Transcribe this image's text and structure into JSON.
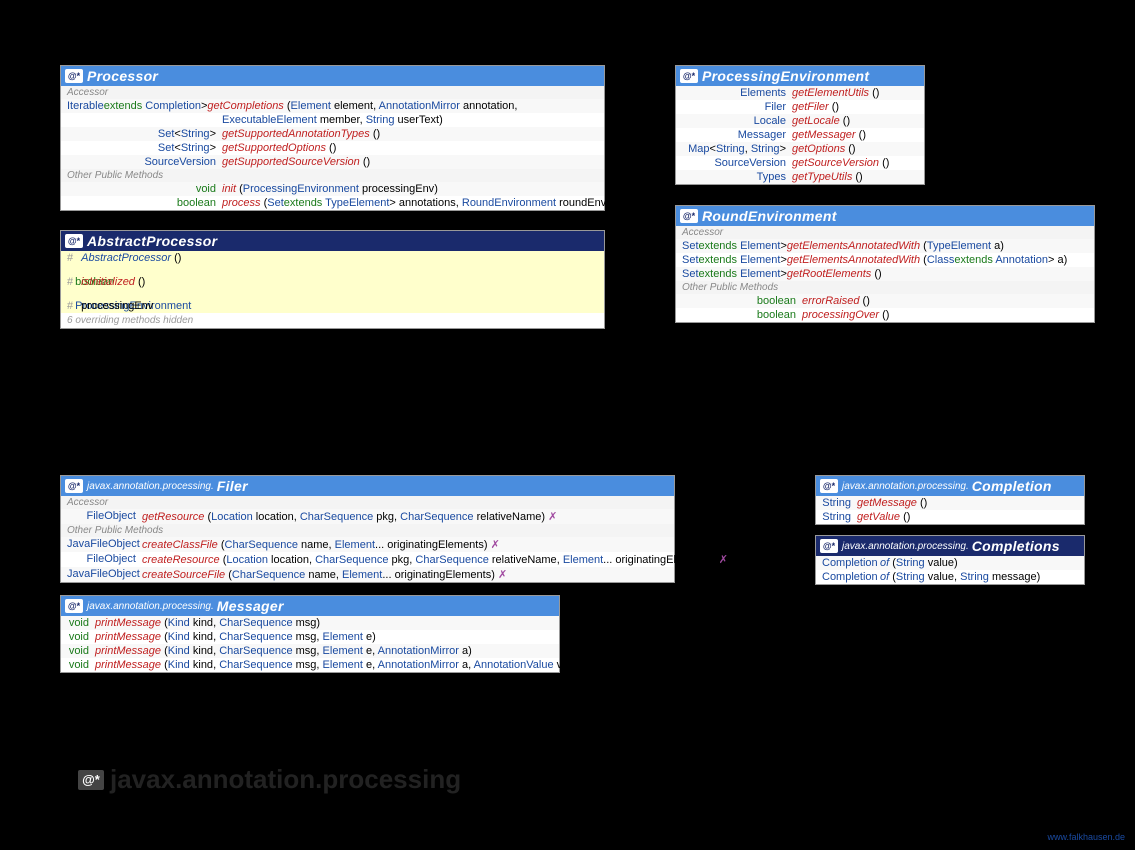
{
  "badge": "@*",
  "footer": {
    "title": "javax.annotation.processing"
  },
  "credit": "www.falkhausen.de",
  "boxes": {
    "processor": {
      "title": "Processor",
      "secAccessor": "Accessor",
      "secOther": "Other Public Methods",
      "rows": [
        {
          "ret": "Iterable<? extends Completion>",
          "m": "getCompletions",
          "sig": "(Element element, AnnotationMirror annotation,"
        },
        {
          "ret": "",
          "m": "",
          "sig": "ExecutableElement member, String userText)"
        },
        {
          "ret": "Set<String>",
          "m": "getSupportedAnnotationTypes",
          "sig": "()"
        },
        {
          "ret": "Set<String>",
          "m": "getSupportedOptions",
          "sig": "()"
        },
        {
          "ret": "SourceVersion",
          "m": "getSupportedSourceVersion",
          "sig": "()"
        }
      ],
      "other": [
        {
          "ret": "void",
          "m": "init",
          "sig": "(ProcessingEnvironment processingEnv)"
        },
        {
          "ret": "boolean",
          "m": "process",
          "sig": "(Set<? extends TypeElement> annotations, RoundEnvironment roundEnv)"
        }
      ]
    },
    "abstractProcessor": {
      "title": "AbstractProcessor",
      "rows": [
        {
          "hash": true,
          "ret": "",
          "m": "AbstractProcessor",
          "sig": "()",
          "mcolor": "#1a4aa0"
        },
        {
          "hash": true,
          "ret": "boolean",
          "m": "isInitialized",
          "sig": "()"
        },
        {
          "hash": true,
          "ret": "ProcessingEnvironment",
          "m": "",
          "sig": "processingEnv",
          "plain": true
        }
      ],
      "note": "6 overriding methods hidden"
    },
    "procEnv": {
      "title": "ProcessingEnvironment",
      "rows": [
        {
          "ret": "Elements",
          "m": "getElementUtils",
          "sig": "()"
        },
        {
          "ret": "Filer",
          "m": "getFiler",
          "sig": "()"
        },
        {
          "ret": "Locale",
          "m": "getLocale",
          "sig": "()"
        },
        {
          "ret": "Messager",
          "m": "getMessager",
          "sig": "()"
        },
        {
          "ret": "Map<String, String>",
          "m": "getOptions",
          "sig": "()"
        },
        {
          "ret": "SourceVersion",
          "m": "getSourceVersion",
          "sig": "()"
        },
        {
          "ret": "Types",
          "m": "getTypeUtils",
          "sig": "()"
        }
      ]
    },
    "roundEnv": {
      "title": "RoundEnvironment",
      "secAccessor": "Accessor",
      "secOther": "Other Public Methods",
      "rows": [
        {
          "ret": "Set<? extends Element>",
          "m": "getElementsAnnotatedWith",
          "sig": "(TypeElement a)"
        },
        {
          "ret": "Set<? extends Element>",
          "m": "getElementsAnnotatedWith",
          "sig": "(Class<? extends Annotation> a)"
        },
        {
          "ret": "Set<? extends Element>",
          "m": "getRootElements",
          "sig": "()"
        }
      ],
      "other": [
        {
          "ret": "boolean",
          "m": "errorRaised",
          "sig": "()"
        },
        {
          "ret": "boolean",
          "m": "processingOver",
          "sig": "()"
        }
      ]
    },
    "filer": {
      "pfx": "javax.annotation.processing.",
      "title": "Filer",
      "secAccessor": "Accessor",
      "secOther": "Other Public Methods",
      "rows": [
        {
          "ret": "FileObject",
          "m": "getResource",
          "sig": "(Location location, CharSequence pkg, CharSequence relativeName)",
          "throws": true
        }
      ],
      "other": [
        {
          "ret": "JavaFileObject",
          "m": "createClassFile",
          "sig": "(CharSequence name, Element... originatingElements)",
          "throws": true
        },
        {
          "ret": "FileObject",
          "m": "createResource",
          "sig": "(Location location, CharSequence pkg, CharSequence relativeName, Element... originatingElements)",
          "throws": true
        },
        {
          "ret": "JavaFileObject",
          "m": "createSourceFile",
          "sig": "(CharSequence name, Element... originatingElements)",
          "throws": true
        }
      ]
    },
    "messager": {
      "pfx": "javax.annotation.processing.",
      "title": "Messager",
      "rows": [
        {
          "ret": "void",
          "m": "printMessage",
          "sig": "(Kind kind, CharSequence msg)"
        },
        {
          "ret": "void",
          "m": "printMessage",
          "sig": "(Kind kind, CharSequence msg, Element e)"
        },
        {
          "ret": "void",
          "m": "printMessage",
          "sig": "(Kind kind, CharSequence msg, Element e, AnnotationMirror a)"
        },
        {
          "ret": "void",
          "m": "printMessage",
          "sig": "(Kind kind, CharSequence msg, Element e, AnnotationMirror a, AnnotationValue v)"
        }
      ]
    },
    "completion": {
      "pfx": "javax.annotation.processing.",
      "title": "Completion",
      "rows": [
        {
          "ret": "String",
          "m": "getMessage",
          "sig": "()"
        },
        {
          "ret": "String",
          "m": "getValue",
          "sig": "()"
        }
      ]
    },
    "completions": {
      "pfx": "javax.annotation.processing.",
      "title": "Completions",
      "rows": [
        {
          "ret": "Completion",
          "m": "of",
          "sig": "(String value)",
          "mcolor": "#1a4aa0"
        },
        {
          "ret": "Completion",
          "m": "of",
          "sig": "(String value, String message)",
          "mcolor": "#1a4aa0"
        }
      ]
    }
  }
}
